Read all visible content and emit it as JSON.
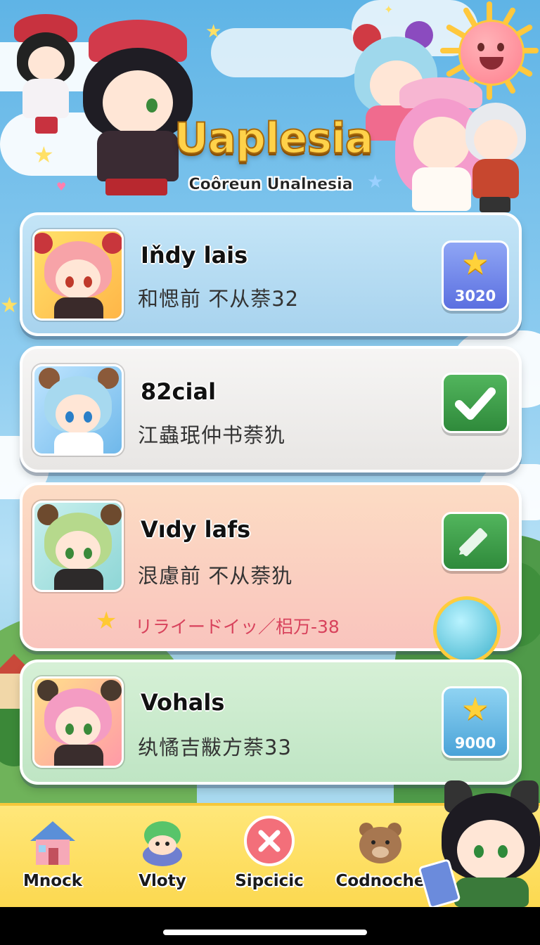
{
  "header": {
    "title": "Uaplesia",
    "subtitle": "Coôreun Unalnesia"
  },
  "cards": [
    {
      "name": "Iňdy lais",
      "description": "和愢前 不从萘32",
      "action": {
        "type": "reward",
        "icon": "star-icon",
        "value": "3020"
      }
    },
    {
      "name": "82cial",
      "description": "江蟲珉仲书萘犰",
      "action": {
        "type": "check",
        "icon": "checkmark-icon"
      }
    },
    {
      "name": "Vıdy lafs",
      "description": "泿慮前 不从萘犰",
      "extra": "リライードイッ／梠万-38",
      "action": {
        "type": "edit",
        "icon": "pencil-icon"
      }
    },
    {
      "name": "Vohals",
      "description": "纨憰吉黻方萘33",
      "action": {
        "type": "reward",
        "icon": "stars-icon",
        "value": "9000"
      }
    }
  ],
  "nav": {
    "items": [
      {
        "label": "Mnock",
        "icon": "house-icon"
      },
      {
        "label": "Vloty",
        "icon": "frog-hat-icon"
      },
      {
        "label": "Sipcicic",
        "icon": "cancel-icon"
      },
      {
        "label": "Codnoche",
        "icon": "bear-icon"
      }
    ]
  },
  "colors": {
    "sky": "#5fb4e6",
    "title": "#ffd24a",
    "card1": "#b5dcf2",
    "card2": "#f1efef",
    "card3": "#fbd8c4",
    "card4": "#cdeccf",
    "nav": "#fcd84f",
    "accent_green": "#3e9a4a",
    "accent_blue": "#5b6fe0"
  }
}
